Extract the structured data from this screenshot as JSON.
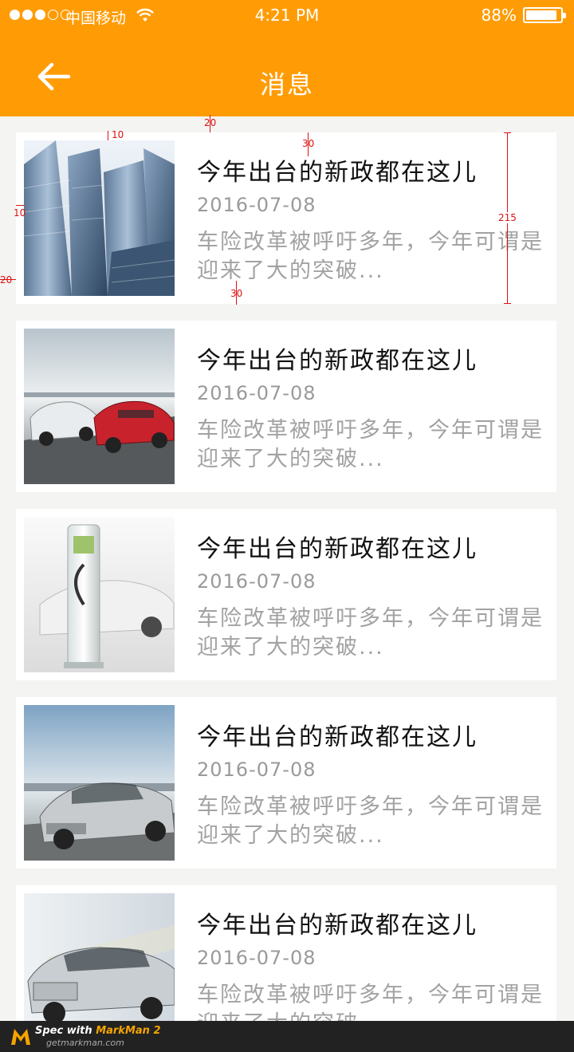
{
  "status_bar": {
    "carrier": "中国移动",
    "time": "4:21 PM",
    "battery": "88%",
    "signal_bars_filled": 3,
    "signal_bars_total": 5
  },
  "nav": {
    "title": "消息",
    "back_icon": "arrow-left-icon"
  },
  "colors": {
    "header": "#ff9c05",
    "background": "#f4f4f2",
    "spec_annotation": "#dd1111"
  },
  "messages": [
    {
      "title": "今年出台的新政都在这儿",
      "date": "2016-07-08",
      "summary": "车险改革被呼吁多年，今年可谓是迎来了大的突破...",
      "image": "city-skyscrapers"
    },
    {
      "title": "今年出台的新政都在这儿",
      "date": "2016-07-08",
      "summary": "车险改革被呼吁多年，今年可谓是迎来了大的突破...",
      "image": "two-cars-on-road"
    },
    {
      "title": "今年出台的新政都在这儿",
      "date": "2016-07-08",
      "summary": "车险改革被呼吁多年，今年可谓是迎来了大的突破...",
      "image": "ev-charging-station"
    },
    {
      "title": "今年出台的新政都在这儿",
      "date": "2016-07-08",
      "summary": "车险改革被呼吁多年，今年可谓是迎来了大的突破...",
      "image": "silver-sedan"
    },
    {
      "title": "今年出台的新政都在这儿",
      "date": "2016-07-08",
      "summary": "车险改革被呼吁多年，今年可谓是迎来了大的突破...",
      "image": "luxury-sedan"
    }
  ],
  "spec_annotations": {
    "top_padding": "20",
    "image_inset_top": "10",
    "image_inset_left": "10",
    "card_margin_left": "20",
    "text_top": "30",
    "text_bottom": "30",
    "card_height": "215"
  },
  "footer": {
    "prefix": "Spec with ",
    "brand": "MarkMan 2",
    "url": "getmarkman.com"
  }
}
